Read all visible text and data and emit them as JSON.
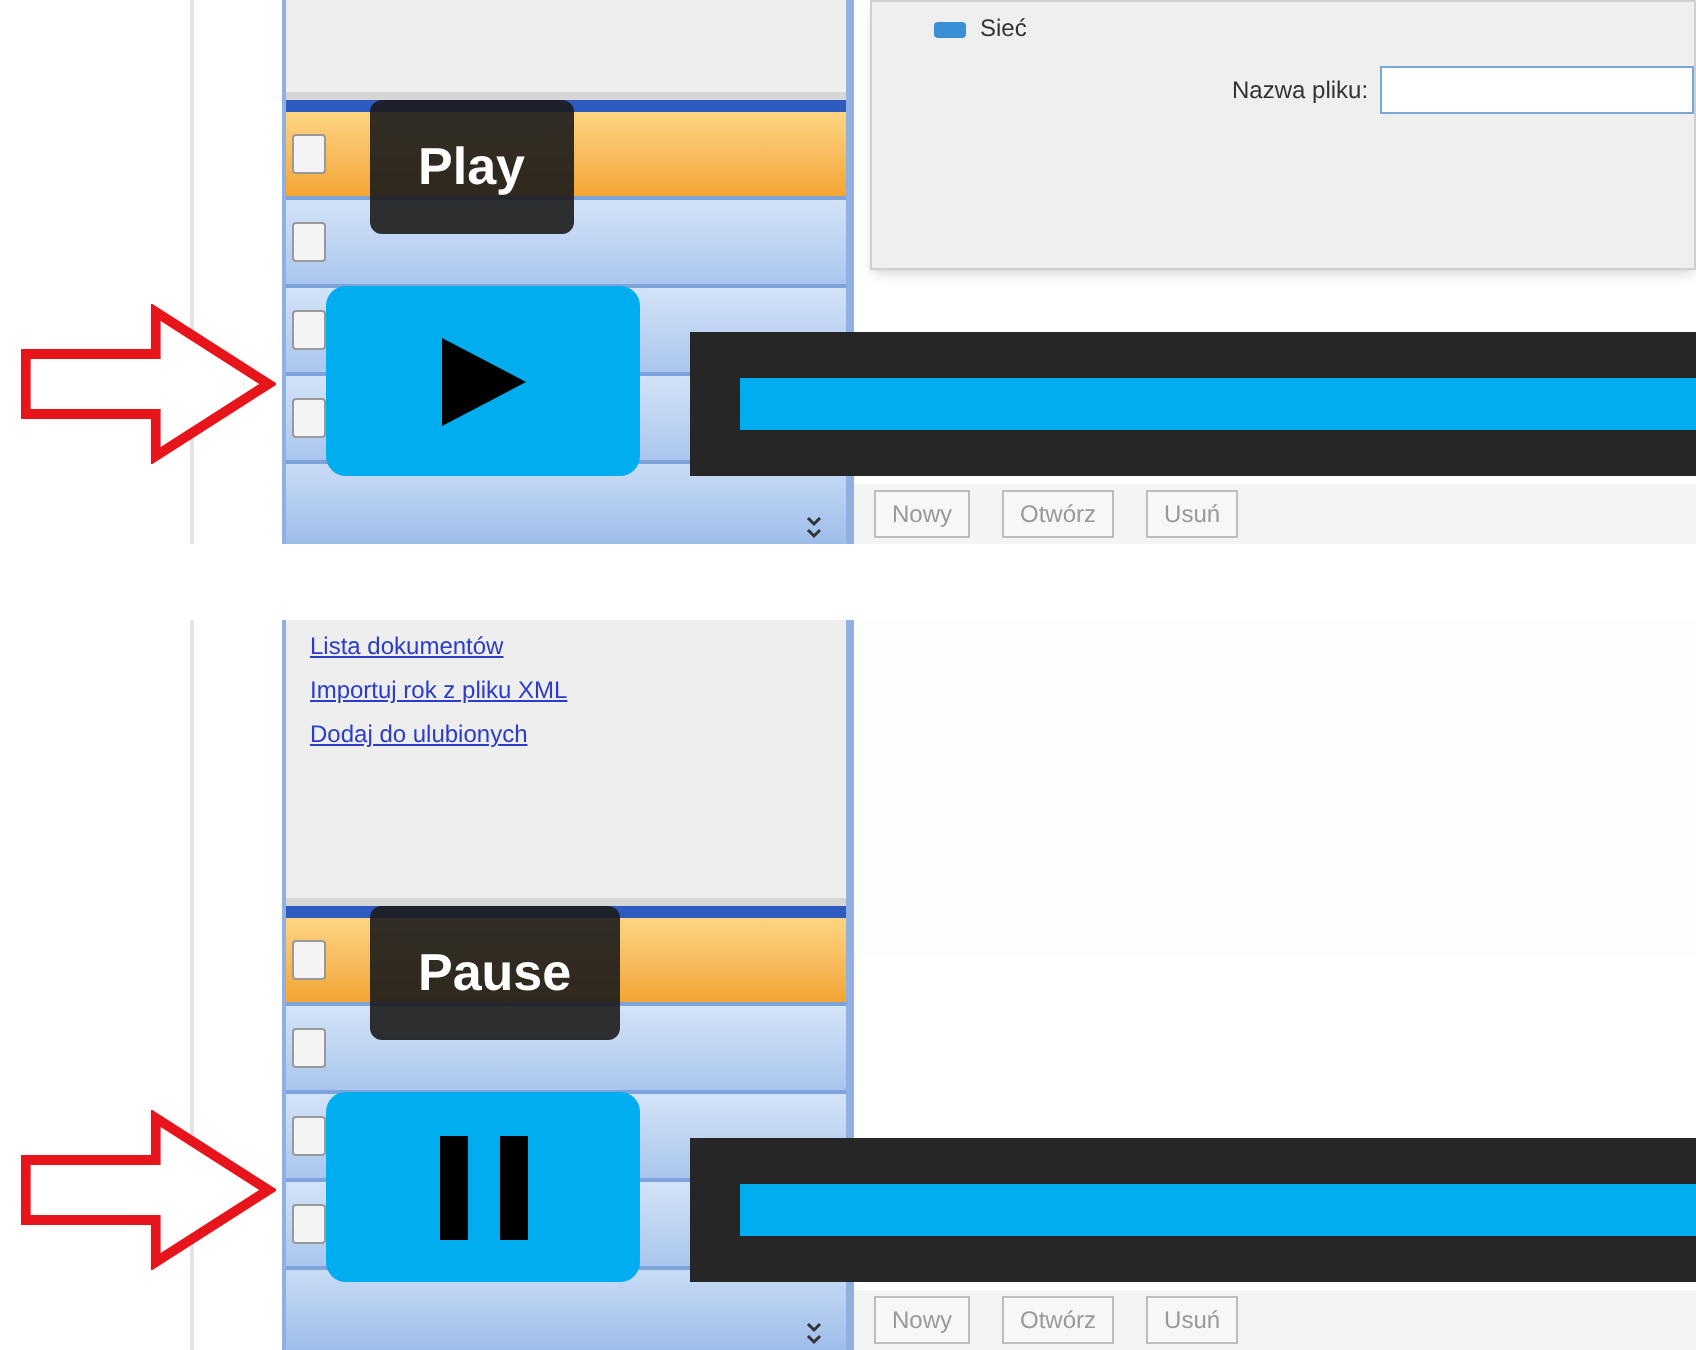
{
  "panels": [
    {
      "kind": "play",
      "tooltip": "Play",
      "dialog": {
        "network": "Sieć",
        "filename_label": "Nazwa pliku:"
      },
      "items": [
        {
          "selected": true
        },
        {
          "selected": false
        },
        {
          "selected": false
        },
        {
          "selected": false
        }
      ],
      "toolbar": [
        "Nowy",
        "Otwórz",
        "Usuń"
      ],
      "progress": {
        "level": 1
      }
    },
    {
      "kind": "pause",
      "tooltip": "Pause",
      "links": [
        "Lista dokumentów",
        "Importuj rok z pliku XML",
        "Dodaj do ulubionych"
      ],
      "items": [
        {
          "selected": true
        },
        {
          "selected": false
        },
        {
          "selected": false
        },
        {
          "selected": false
        }
      ],
      "toolbar": [
        "Nowy",
        "Otwórz",
        "Usuń"
      ],
      "progress": {
        "level": 1
      }
    }
  ]
}
